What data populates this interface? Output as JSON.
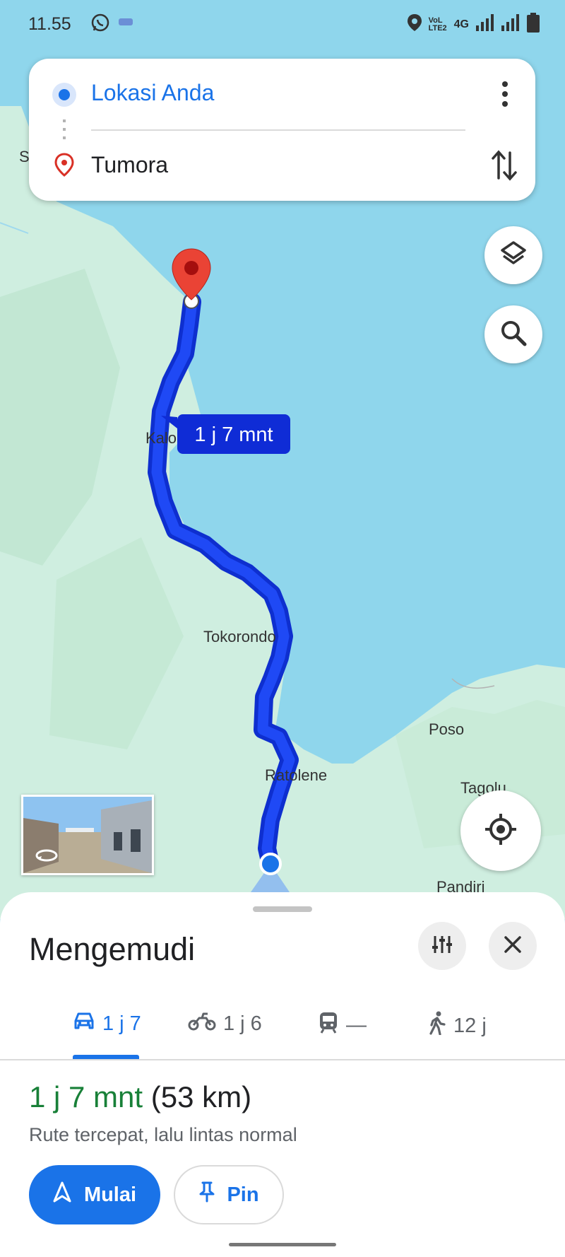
{
  "status_bar": {
    "time": "11.55",
    "network_label": "4G",
    "icons": [
      "whatsapp-icon",
      "notification-icon",
      "location-icon",
      "volte-icon",
      "signal-icon",
      "signal-icon",
      "battery-icon"
    ]
  },
  "search": {
    "origin": "Lokasi Anda",
    "destination": "Tumora",
    "icons": [
      "origin-dot-icon",
      "destination-pin-icon",
      "more-vert-icon",
      "swap-icon"
    ]
  },
  "map": {
    "eta_bubble": "1 j 7 mnt",
    "places": [
      "S",
      "Kalo",
      "Tokorondo",
      "Ratolene",
      "Poso",
      "Tagolu",
      "Pandiri"
    ],
    "buttons": [
      "layers-icon",
      "search-icon",
      "my-location-icon"
    ],
    "colors": {
      "water": "#8fd6ec",
      "land": "#cfeee0",
      "route": "#1a3cf0",
      "route_label_bg": "#0f2cd6",
      "pin": "#ea4335"
    }
  },
  "sheet": {
    "title": "Mengemudi",
    "tabs": [
      {
        "mode": "car",
        "icon": "car-icon",
        "label": "1 j 7",
        "active": true
      },
      {
        "mode": "motorcycle",
        "icon": "motorcycle-icon",
        "label": "1 j 6",
        "active": false
      },
      {
        "mode": "transit",
        "icon": "train-icon",
        "label": "—",
        "active": false
      },
      {
        "mode": "walk",
        "icon": "walking-icon",
        "label": "12 j",
        "active": false
      }
    ],
    "eta_time": "1 j 7 mnt",
    "eta_distance": "(53 km)",
    "route_description": "Rute tercepat, lalu lintas normal",
    "start_label": "Mulai",
    "pin_label": "Pin",
    "icons": [
      "options-icon",
      "close-icon",
      "navigation-arrow-icon",
      "pin-icon"
    ],
    "colors": {
      "accent": "#1a73e8",
      "eta_green": "#188038"
    }
  }
}
